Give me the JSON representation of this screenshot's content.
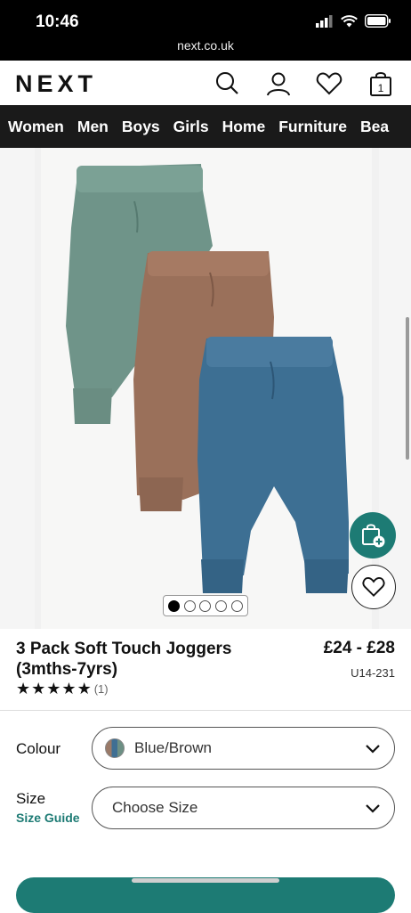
{
  "status": {
    "time": "10:46",
    "url": "next.co.uk"
  },
  "header": {
    "logo": "NEXT",
    "bag_count": "1"
  },
  "nav": {
    "items": [
      "Women",
      "Men",
      "Boys",
      "Girls",
      "Home",
      "Furniture",
      "Bea"
    ]
  },
  "gallery": {
    "total_images": 5,
    "active_index": 0
  },
  "product": {
    "title_line1": "3 Pack Soft Touch Joggers",
    "title_line2": "(3mths-7yrs)",
    "price": "£24 - £28",
    "code": "U14-231",
    "rating_stars": 5,
    "rating_count": "(1)"
  },
  "options": {
    "colour_label": "Colour",
    "colour_value": "Blue/Brown",
    "size_label": "Size",
    "size_guide": "Size Guide",
    "size_placeholder": "Choose Size"
  },
  "colors": {
    "accent": "#1d7b74",
    "nav_bg": "#1a1a1a",
    "green_pants": "#6f9489",
    "brown_pants": "#9a705a",
    "blue_pants": "#3d6f93"
  }
}
